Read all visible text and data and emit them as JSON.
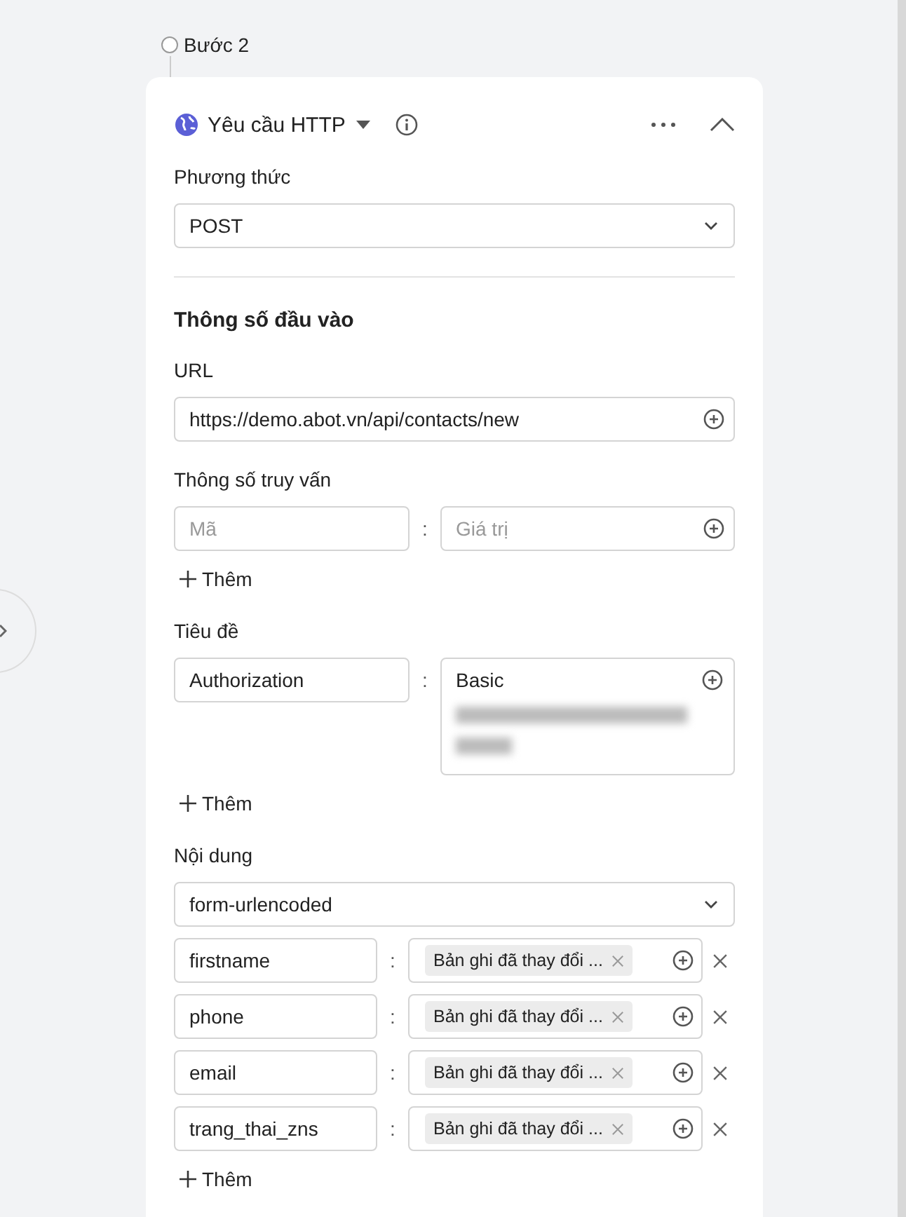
{
  "step": {
    "label": "Bước 2"
  },
  "block": {
    "title": "Yêu cầu HTTP",
    "expanded": true
  },
  "separator": ":",
  "method": {
    "label": "Phương thức",
    "value": "POST"
  },
  "section_title": "Thông số đầu vào",
  "url": {
    "label": "URL",
    "value": "https://demo.abot.vn/api/contacts/new"
  },
  "query": {
    "label": "Thông số truy vấn",
    "add": "Thêm",
    "rows": [
      {
        "key_placeholder": "Mã",
        "value_placeholder": "Giá trị"
      }
    ]
  },
  "headers": {
    "label": "Tiêu đề",
    "add": "Thêm",
    "rows": [
      {
        "key": "Authorization",
        "value": "Basic"
      }
    ]
  },
  "body": {
    "label": "Nội dung",
    "type": "form-urlencoded",
    "add": "Thêm",
    "rows": [
      {
        "key": "firstname",
        "tag": "Bản ghi đã thay đổi ..."
      },
      {
        "key": "phone",
        "tag": "Bản ghi đã thay đổi ..."
      },
      {
        "key": "email",
        "tag": "Bản ghi đã thay đổi ..."
      },
      {
        "key": "trang_thai_zns",
        "tag": "Bản ghi đã thay đổi ..."
      }
    ]
  }
}
